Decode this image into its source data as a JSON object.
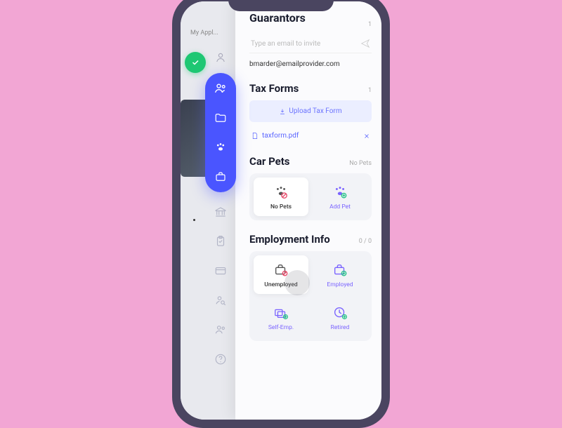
{
  "back": {
    "title": "My Appl..."
  },
  "sections": {
    "guarantors": {
      "title": "Guarantors",
      "count": "1",
      "invite_placeholder": "Type an email to invite",
      "email": "bmarder@emailprovider.com"
    },
    "tax": {
      "title": "Tax Forms",
      "count": "1",
      "upload_label": "Upload Tax Form",
      "file": "taxform.pdf"
    },
    "pets": {
      "title": "Car Pets",
      "status": "No Pets",
      "no_pets": "No Pets",
      "add_pet": "Add Pet"
    },
    "employment": {
      "title": "Employment Info",
      "status": "0 / 0",
      "unemployed": "Unemployed",
      "employed": "Employed",
      "self_emp": "Self-Emp.",
      "retired": "Retired"
    }
  }
}
